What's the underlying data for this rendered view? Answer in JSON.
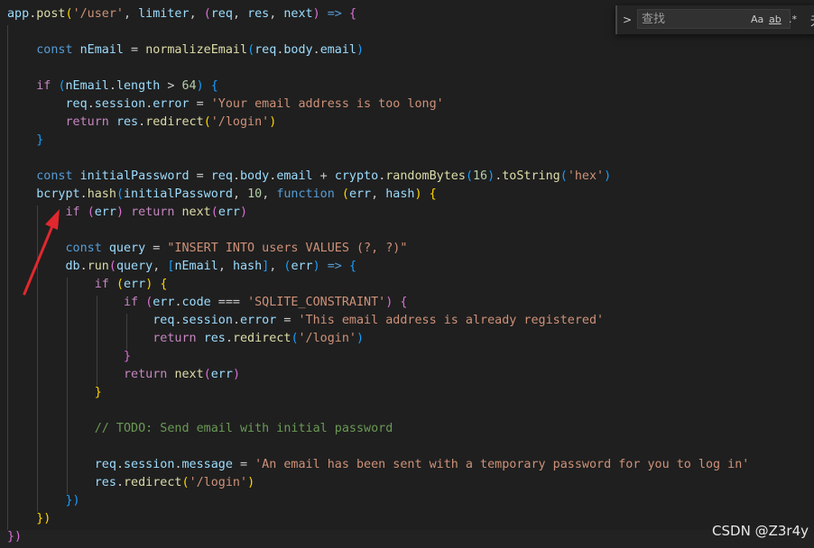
{
  "editor": {
    "lines": [
      [
        [
          "app",
          "t-var"
        ],
        [
          ".",
          "t-plain"
        ],
        [
          "post",
          "t-fn"
        ],
        [
          "(",
          "t-br1"
        ],
        [
          "'/user'",
          "t-str"
        ],
        [
          ", ",
          "t-plain"
        ],
        [
          "limiter",
          "t-var"
        ],
        [
          ", ",
          "t-plain"
        ],
        [
          "(",
          "t-br2"
        ],
        [
          "req",
          "t-var"
        ],
        [
          ", ",
          "t-plain"
        ],
        [
          "res",
          "t-var"
        ],
        [
          ", ",
          "t-plain"
        ],
        [
          "next",
          "t-var"
        ],
        [
          ")",
          "t-br2"
        ],
        [
          " ",
          "t-plain"
        ],
        [
          "=>",
          "t-kw"
        ],
        [
          " ",
          "t-plain"
        ],
        [
          "{",
          "t-br2"
        ]
      ],
      [],
      [
        [
          "    ",
          "t-plain"
        ],
        [
          "const",
          "t-kw"
        ],
        [
          " ",
          "t-plain"
        ],
        [
          "nEmail",
          "t-var"
        ],
        [
          " = ",
          "t-plain"
        ],
        [
          "normalizeEmail",
          "t-fn"
        ],
        [
          "(",
          "t-br3"
        ],
        [
          "req",
          "t-var"
        ],
        [
          ".",
          "t-plain"
        ],
        [
          "body",
          "t-var"
        ],
        [
          ".",
          "t-plain"
        ],
        [
          "email",
          "t-var"
        ],
        [
          ")",
          "t-br3"
        ]
      ],
      [],
      [
        [
          "    ",
          "t-plain"
        ],
        [
          "if",
          "t-ctl"
        ],
        [
          " ",
          "t-plain"
        ],
        [
          "(",
          "t-br3"
        ],
        [
          "nEmail",
          "t-var"
        ],
        [
          ".",
          "t-plain"
        ],
        [
          "length",
          "t-var"
        ],
        [
          " > ",
          "t-plain"
        ],
        [
          "64",
          "t-num"
        ],
        [
          ")",
          "t-br3"
        ],
        [
          " ",
          "t-plain"
        ],
        [
          "{",
          "t-br3"
        ]
      ],
      [
        [
          "        ",
          "t-plain"
        ],
        [
          "req",
          "t-var"
        ],
        [
          ".",
          "t-plain"
        ],
        [
          "session",
          "t-var"
        ],
        [
          ".",
          "t-plain"
        ],
        [
          "error",
          "t-var"
        ],
        [
          " = ",
          "t-plain"
        ],
        [
          "'Your email address is too long'",
          "t-str"
        ]
      ],
      [
        [
          "        ",
          "t-plain"
        ],
        [
          "return",
          "t-ctl"
        ],
        [
          " ",
          "t-plain"
        ],
        [
          "res",
          "t-var"
        ],
        [
          ".",
          "t-plain"
        ],
        [
          "redirect",
          "t-fn"
        ],
        [
          "(",
          "t-br1"
        ],
        [
          "'/login'",
          "t-str"
        ],
        [
          ")",
          "t-br1"
        ]
      ],
      [
        [
          "    ",
          "t-plain"
        ],
        [
          "}",
          "t-br3"
        ]
      ],
      [],
      [
        [
          "    ",
          "t-plain"
        ],
        [
          "const",
          "t-kw"
        ],
        [
          " ",
          "t-plain"
        ],
        [
          "initialPassword",
          "t-var"
        ],
        [
          " = ",
          "t-plain"
        ],
        [
          "req",
          "t-var"
        ],
        [
          ".",
          "t-plain"
        ],
        [
          "body",
          "t-var"
        ],
        [
          ".",
          "t-plain"
        ],
        [
          "email",
          "t-var"
        ],
        [
          " + ",
          "t-plain"
        ],
        [
          "crypto",
          "t-var"
        ],
        [
          ".",
          "t-plain"
        ],
        [
          "randomBytes",
          "t-fn"
        ],
        [
          "(",
          "t-br3"
        ],
        [
          "16",
          "t-num"
        ],
        [
          ")",
          "t-br3"
        ],
        [
          ".",
          "t-plain"
        ],
        [
          "toString",
          "t-fn"
        ],
        [
          "(",
          "t-br3"
        ],
        [
          "'hex'",
          "t-str"
        ],
        [
          ")",
          "t-br3"
        ]
      ],
      [
        [
          "    ",
          "t-plain"
        ],
        [
          "bcrypt",
          "t-var"
        ],
        [
          ".",
          "t-plain"
        ],
        [
          "hash",
          "t-fn"
        ],
        [
          "(",
          "t-br3"
        ],
        [
          "initialPassword",
          "t-var"
        ],
        [
          ", ",
          "t-plain"
        ],
        [
          "10",
          "t-num"
        ],
        [
          ", ",
          "t-plain"
        ],
        [
          "function",
          "t-kw"
        ],
        [
          " ",
          "t-plain"
        ],
        [
          "(",
          "t-br1"
        ],
        [
          "err",
          "t-var"
        ],
        [
          ", ",
          "t-plain"
        ],
        [
          "hash",
          "t-var"
        ],
        [
          ")",
          "t-br1"
        ],
        [
          " ",
          "t-plain"
        ],
        [
          "{",
          "t-br1"
        ]
      ],
      [
        [
          "        ",
          "t-plain"
        ],
        [
          "if",
          "t-ctl"
        ],
        [
          " ",
          "t-plain"
        ],
        [
          "(",
          "t-br2"
        ],
        [
          "err",
          "t-var"
        ],
        [
          ")",
          "t-br2"
        ],
        [
          " ",
          "t-plain"
        ],
        [
          "return",
          "t-ctl"
        ],
        [
          " ",
          "t-plain"
        ],
        [
          "next",
          "t-fn"
        ],
        [
          "(",
          "t-br2"
        ],
        [
          "err",
          "t-var"
        ],
        [
          ")",
          "t-br2"
        ]
      ],
      [],
      [
        [
          "        ",
          "t-plain"
        ],
        [
          "const",
          "t-kw"
        ],
        [
          " ",
          "t-plain"
        ],
        [
          "query",
          "t-var"
        ],
        [
          " = ",
          "t-plain"
        ],
        [
          "\"INSERT INTO users VALUES (?, ?)\"",
          "t-str"
        ]
      ],
      [
        [
          "        ",
          "t-plain"
        ],
        [
          "db",
          "t-var"
        ],
        [
          ".",
          "t-plain"
        ],
        [
          "run",
          "t-fn"
        ],
        [
          "(",
          "t-br2"
        ],
        [
          "query",
          "t-var"
        ],
        [
          ", ",
          "t-plain"
        ],
        [
          "[",
          "t-br3"
        ],
        [
          "nEmail",
          "t-var"
        ],
        [
          ", ",
          "t-plain"
        ],
        [
          "hash",
          "t-var"
        ],
        [
          "]",
          "t-br3"
        ],
        [
          ", ",
          "t-plain"
        ],
        [
          "(",
          "t-br3"
        ],
        [
          "err",
          "t-var"
        ],
        [
          ")",
          "t-br3"
        ],
        [
          " ",
          "t-plain"
        ],
        [
          "=>",
          "t-kw"
        ],
        [
          " ",
          "t-plain"
        ],
        [
          "{",
          "t-br3"
        ]
      ],
      [
        [
          "            ",
          "t-plain"
        ],
        [
          "if",
          "t-ctl"
        ],
        [
          " ",
          "t-plain"
        ],
        [
          "(",
          "t-br1"
        ],
        [
          "err",
          "t-var"
        ],
        [
          ")",
          "t-br1"
        ],
        [
          " ",
          "t-plain"
        ],
        [
          "{",
          "t-br1"
        ]
      ],
      [
        [
          "                ",
          "t-plain"
        ],
        [
          "if",
          "t-ctl"
        ],
        [
          " ",
          "t-plain"
        ],
        [
          "(",
          "t-br2"
        ],
        [
          "err",
          "t-var"
        ],
        [
          ".",
          "t-plain"
        ],
        [
          "code",
          "t-var"
        ],
        [
          " === ",
          "t-plain"
        ],
        [
          "'SQLITE_CONSTRAINT'",
          "t-str"
        ],
        [
          ")",
          "t-br2"
        ],
        [
          " ",
          "t-plain"
        ],
        [
          "{",
          "t-br2"
        ]
      ],
      [
        [
          "                    ",
          "t-plain"
        ],
        [
          "req",
          "t-var"
        ],
        [
          ".",
          "t-plain"
        ],
        [
          "session",
          "t-var"
        ],
        [
          ".",
          "t-plain"
        ],
        [
          "error",
          "t-var"
        ],
        [
          " = ",
          "t-plain"
        ],
        [
          "'This email address is already registered'",
          "t-str"
        ]
      ],
      [
        [
          "                    ",
          "t-plain"
        ],
        [
          "return",
          "t-ctl"
        ],
        [
          " ",
          "t-plain"
        ],
        [
          "res",
          "t-var"
        ],
        [
          ".",
          "t-plain"
        ],
        [
          "redirect",
          "t-fn"
        ],
        [
          "(",
          "t-br3"
        ],
        [
          "'/login'",
          "t-str"
        ],
        [
          ")",
          "t-br3"
        ]
      ],
      [
        [
          "                ",
          "t-plain"
        ],
        [
          "}",
          "t-br2"
        ]
      ],
      [
        [
          "                ",
          "t-plain"
        ],
        [
          "return",
          "t-ctl"
        ],
        [
          " ",
          "t-plain"
        ],
        [
          "next",
          "t-fn"
        ],
        [
          "(",
          "t-br2"
        ],
        [
          "err",
          "t-var"
        ],
        [
          ")",
          "t-br2"
        ]
      ],
      [
        [
          "            ",
          "t-plain"
        ],
        [
          "}",
          "t-br1"
        ]
      ],
      [],
      [
        [
          "            ",
          "t-plain"
        ],
        [
          "// TODO: Send email with initial password",
          "t-cmt"
        ]
      ],
      [],
      [
        [
          "            ",
          "t-plain"
        ],
        [
          "req",
          "t-var"
        ],
        [
          ".",
          "t-plain"
        ],
        [
          "session",
          "t-var"
        ],
        [
          ".",
          "t-plain"
        ],
        [
          "message",
          "t-var"
        ],
        [
          " = ",
          "t-plain"
        ],
        [
          "'An email has been sent with a temporary password for you to log in'",
          "t-str"
        ]
      ],
      [
        [
          "            ",
          "t-plain"
        ],
        [
          "res",
          "t-var"
        ],
        [
          ".",
          "t-plain"
        ],
        [
          "redirect",
          "t-fn"
        ],
        [
          "(",
          "t-br1"
        ],
        [
          "'/login'",
          "t-str"
        ],
        [
          ")",
          "t-br1"
        ]
      ],
      [
        [
          "        ",
          "t-plain"
        ],
        [
          "})",
          "t-br3"
        ]
      ],
      [
        [
          "    ",
          "t-plain"
        ],
        [
          "})",
          "t-br1"
        ]
      ],
      [
        [
          "})",
          "t-br2"
        ]
      ]
    ]
  },
  "find_widget": {
    "toggle_glyph": ">",
    "placeholder": "查找",
    "match_case_label": "Aa",
    "whole_word_label": "ab",
    "regex_label": ".*",
    "extra_label": "无"
  },
  "watermark": "CSDN @Z3r4y",
  "colors": {
    "background": "#1f1f1f",
    "annotation_arrow": "#e0282e"
  }
}
